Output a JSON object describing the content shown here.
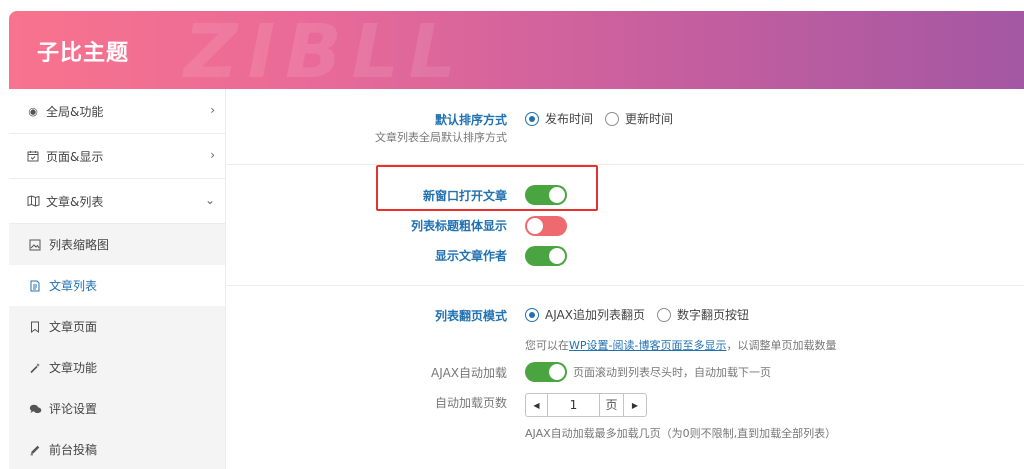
{
  "header": {
    "brand": "子比主题",
    "watermark": "ZIBLL"
  },
  "sidebar": {
    "items": [
      {
        "label": "全局&功能",
        "icon": "target-icon",
        "chevron": "›"
      },
      {
        "label": "页面&显示",
        "icon": "calendar-icon",
        "chevron": "›"
      },
      {
        "label": "文章&列表",
        "icon": "map-icon",
        "chevron": "⌄"
      }
    ],
    "subitems": [
      {
        "label": "列表缩略图",
        "icon": "image-icon"
      },
      {
        "label": "文章列表",
        "icon": "document-icon"
      },
      {
        "label": "文章页面",
        "icon": "bookmark-icon"
      },
      {
        "label": "文章功能",
        "icon": "magic-wand-icon"
      },
      {
        "label": "评论设置",
        "icon": "comments-icon"
      },
      {
        "label": "前台投稿",
        "icon": "pencil-icon"
      }
    ]
  },
  "settings": {
    "sort": {
      "label": "默认排序方式",
      "desc": "文章列表全局默认排序方式",
      "options": [
        "发布时间",
        "更新时间"
      ],
      "selected": "发布时间"
    },
    "new_window": {
      "label": "新窗口打开文章",
      "on": true
    },
    "bold_title": {
      "label": "列表标题粗体显示",
      "on": false
    },
    "show_author": {
      "label": "显示文章作者",
      "on": true
    },
    "paging": {
      "label": "列表翻页模式",
      "options": [
        "AJAX追加列表翻页",
        "数字翻页按钮"
      ],
      "selected": "AJAX追加列表翻页",
      "hint_prefix": "您可以在",
      "hint_link": "WP设置-阅读-博客页面至多显示",
      "hint_suffix": "，以调整单页加载数量"
    },
    "ajax_auto": {
      "label": "AJAX自动加载",
      "on": true,
      "desc": "页面滚动到列表尽头时，自动加载下一页"
    },
    "auto_pages": {
      "label": "自动加载页数",
      "value": "1",
      "unit": "页",
      "hint": "AJAX自动加载最多加载几页（为0则不限制,直到加载全部列表）"
    }
  },
  "colors": {
    "accent": "#2271b1",
    "switch_on": "#4aa43f",
    "switch_off": "#ee6a6f",
    "highlight": "#e8302f"
  }
}
